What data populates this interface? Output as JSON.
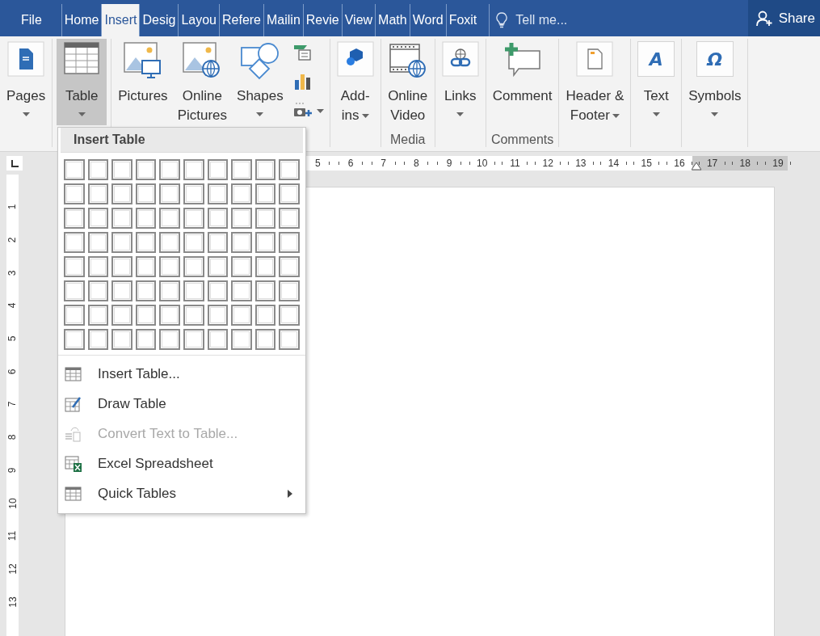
{
  "tabs": [
    {
      "label": "File",
      "selected": false
    },
    {
      "label": "Home",
      "selected": false
    },
    {
      "label": "Insert",
      "selected": true
    },
    {
      "label": "Desig",
      "selected": false
    },
    {
      "label": "Layou",
      "selected": false
    },
    {
      "label": "Refere",
      "selected": false
    },
    {
      "label": "Mailin",
      "selected": false
    },
    {
      "label": "Revie",
      "selected": false
    },
    {
      "label": "View",
      "selected": false
    },
    {
      "label": "Math",
      "selected": false
    },
    {
      "label": "Word",
      "selected": false
    },
    {
      "label": "Foxit",
      "selected": false
    }
  ],
  "tell_me": {
    "placeholder": "Tell me..."
  },
  "share_button": "Share",
  "ribbon": {
    "groups": [
      {
        "buttons": [
          {
            "kind": "large",
            "lines": [
              "Pages"
            ],
            "dropdown": true,
            "pressed": false
          }
        ]
      },
      {
        "buttons": [
          {
            "kind": "large",
            "lines": [
              "Table"
            ],
            "dropdown": true,
            "pressed": true
          }
        ]
      },
      {
        "buttons": [
          {
            "kind": "large",
            "lines": [
              "Pictures"
            ],
            "dropdown": false,
            "pressed": false
          },
          {
            "kind": "large",
            "lines": [
              "Online",
              "Pictures"
            ],
            "dropdown": false,
            "pressed": false
          },
          {
            "kind": "large",
            "lines": [
              "Shapes"
            ],
            "dropdown": true,
            "pressed": false
          },
          {
            "kind": "stack",
            "items": [
              {
                "dropdown": false
              },
              {
                "dropdown": false
              },
              {
                "dropdown": true
              }
            ]
          }
        ]
      },
      {
        "buttons": [
          {
            "kind": "large",
            "lines": [
              "Add-",
              "ins"
            ],
            "dropdown": true,
            "pressed": false
          }
        ]
      },
      {
        "label": "Media",
        "buttons": [
          {
            "kind": "large",
            "lines": [
              "Online",
              "Video"
            ],
            "dropdown": false,
            "pressed": false
          }
        ]
      },
      {
        "buttons": [
          {
            "kind": "large",
            "lines": [
              "Links"
            ],
            "dropdown": true,
            "pressed": false
          }
        ]
      },
      {
        "label": "Comments",
        "buttons": [
          {
            "kind": "large",
            "lines": [
              "Comment"
            ],
            "dropdown": false,
            "pressed": false
          }
        ]
      },
      {
        "buttons": [
          {
            "kind": "large",
            "lines": [
              "Header &",
              "Footer"
            ],
            "dropdown": true,
            "pressed": false
          }
        ]
      },
      {
        "buttons": [
          {
            "kind": "large",
            "lines": [
              "Text"
            ],
            "dropdown": true,
            "pressed": false,
            "glyph": "A"
          }
        ]
      },
      {
        "buttons": [
          {
            "kind": "large",
            "lines": [
              "Symbols"
            ],
            "dropdown": true,
            "pressed": false,
            "glyph": "Ω"
          }
        ]
      }
    ]
  },
  "horizontal_ruler": [
    "5",
    "6",
    "7",
    "8",
    "9",
    "10",
    "11",
    "12",
    "13",
    "14",
    "15",
    "16",
    "17",
    "18",
    "19"
  ],
  "vertical_ruler": [
    "1",
    "2",
    "3",
    "4",
    "5",
    "6",
    "7",
    "8",
    "9",
    "10",
    "11",
    "12",
    "13"
  ],
  "insert_table_menu": {
    "title": "Insert Table",
    "grid": [
      {
        "cells": [
          {
            "selected": false
          },
          {
            "selected": false
          },
          {
            "selected": false
          },
          {
            "selected": false
          },
          {
            "selected": false
          },
          {
            "selected": false
          },
          {
            "selected": false
          },
          {
            "selected": false
          },
          {
            "selected": false
          },
          {
            "selected": false
          }
        ]
      },
      {
        "cells": [
          {
            "selected": false
          },
          {
            "selected": false
          },
          {
            "selected": false
          },
          {
            "selected": false
          },
          {
            "selected": false
          },
          {
            "selected": false
          },
          {
            "selected": false
          },
          {
            "selected": false
          },
          {
            "selected": false
          },
          {
            "selected": false
          }
        ]
      },
      {
        "cells": [
          {
            "selected": false
          },
          {
            "selected": false
          },
          {
            "selected": false
          },
          {
            "selected": false
          },
          {
            "selected": false
          },
          {
            "selected": false
          },
          {
            "selected": false
          },
          {
            "selected": false
          },
          {
            "selected": false
          },
          {
            "selected": false
          }
        ]
      },
      {
        "cells": [
          {
            "selected": false
          },
          {
            "selected": false
          },
          {
            "selected": false
          },
          {
            "selected": false
          },
          {
            "selected": false
          },
          {
            "selected": false
          },
          {
            "selected": false
          },
          {
            "selected": false
          },
          {
            "selected": false
          },
          {
            "selected": false
          }
        ]
      },
      {
        "cells": [
          {
            "selected": false
          },
          {
            "selected": false
          },
          {
            "selected": false
          },
          {
            "selected": false
          },
          {
            "selected": false
          },
          {
            "selected": false
          },
          {
            "selected": false
          },
          {
            "selected": false
          },
          {
            "selected": false
          },
          {
            "selected": false
          }
        ]
      },
      {
        "cells": [
          {
            "selected": false
          },
          {
            "selected": false
          },
          {
            "selected": false
          },
          {
            "selected": false
          },
          {
            "selected": false
          },
          {
            "selected": false
          },
          {
            "selected": false
          },
          {
            "selected": false
          },
          {
            "selected": false
          },
          {
            "selected": false
          }
        ]
      },
      {
        "cells": [
          {
            "selected": false
          },
          {
            "selected": false
          },
          {
            "selected": false
          },
          {
            "selected": false
          },
          {
            "selected": false
          },
          {
            "selected": false
          },
          {
            "selected": false
          },
          {
            "selected": false
          },
          {
            "selected": false
          },
          {
            "selected": false
          }
        ]
      },
      {
        "cells": [
          {
            "selected": false
          },
          {
            "selected": false
          },
          {
            "selected": false
          },
          {
            "selected": false
          },
          {
            "selected": false
          },
          {
            "selected": false
          },
          {
            "selected": false
          },
          {
            "selected": false
          },
          {
            "selected": false
          },
          {
            "selected": false
          }
        ]
      }
    ],
    "items": [
      {
        "label": "Insert Table...",
        "disabled": false,
        "submenu": false
      },
      {
        "label": "Draw Table",
        "disabled": false,
        "submenu": false
      },
      {
        "label": "Convert Text to Table...",
        "disabled": true,
        "submenu": false
      },
      {
        "label": "Excel Spreadsheet",
        "disabled": false,
        "submenu": false
      },
      {
        "label": "Quick Tables",
        "disabled": false,
        "submenu": true
      }
    ]
  }
}
